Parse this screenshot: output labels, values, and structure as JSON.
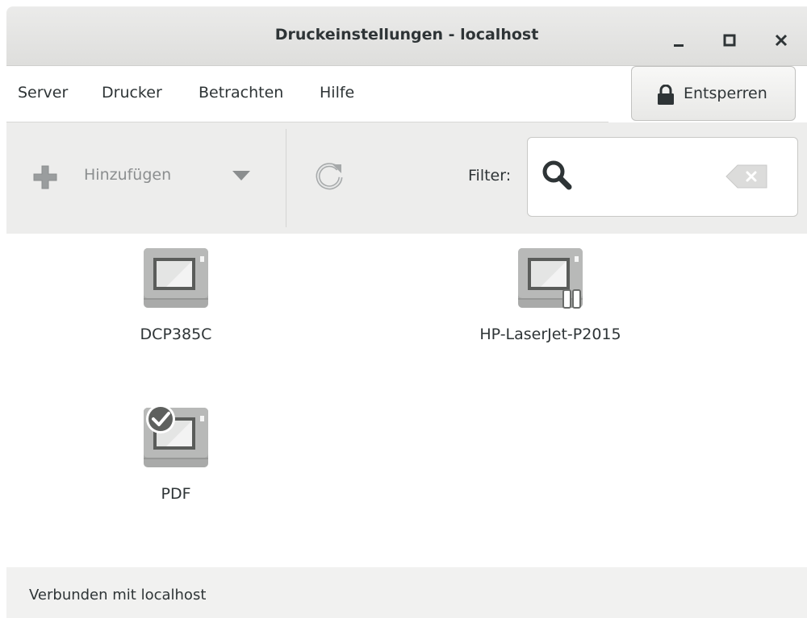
{
  "window": {
    "title": "Druckeinstellungen - localhost"
  },
  "menubar": {
    "items": [
      "Server",
      "Drucker",
      "Betrachten",
      "Hilfe"
    ]
  },
  "unlock_button": {
    "label": "Entsperren",
    "icon": "lock-icon"
  },
  "toolbar": {
    "add_label": "Hinzufügen",
    "filter_label": "Filter:",
    "filter_value": "",
    "icons": [
      "plus-icon",
      "dropdown-arrow-icon",
      "refresh-icon",
      "search-icon",
      "clear-icon"
    ]
  },
  "printers": [
    {
      "name": "DCP385C",
      "default": false,
      "paused": false
    },
    {
      "name": "HP-LaserJet-P2015",
      "default": false,
      "paused": true
    },
    {
      "name": "PDF",
      "default": true,
      "paused": false
    }
  ],
  "statusbar": {
    "text": "Verbunden mit localhost"
  },
  "colors": {
    "toolbar_bg": "#ededec",
    "titlebar_bg": "#e4e4e2",
    "statusbar_bg": "#f1f1f0",
    "disabled_text": "#8b8e8f"
  }
}
